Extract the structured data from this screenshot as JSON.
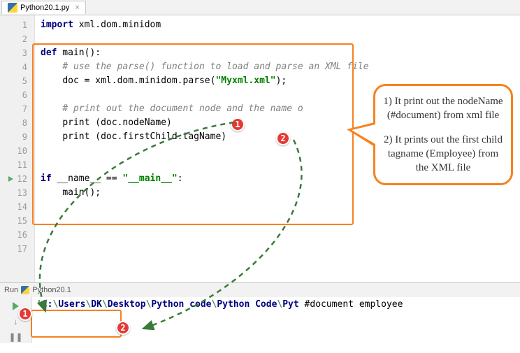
{
  "tab": {
    "filename": "Python20.1.py",
    "close": "×"
  },
  "code": {
    "l1_import": "import",
    "l1_module": " xml.dom.minidom",
    "l3_def": "def",
    "l3_sig": " main():",
    "l4_comment": "# use the parse() function to load and parse an XML file",
    "l5_a": "doc = xml.dom.minidom.parse(",
    "l5_str": "\"Myxml.xml\"",
    "l5_b": ");",
    "l7_comment": "# print out the document node and the name o",
    "l8_a": "print (doc.nodeName)",
    "l9_a": "print (doc.firstChild.tagName)",
    "l12_if": "if",
    "l12_a": " __name__ == ",
    "l12_str": "\"__main__\"",
    "l12_b": ":",
    "l13_a": "main();"
  },
  "gutter": {
    "lines": [
      "1",
      "2",
      "3",
      "4",
      "5",
      "6",
      "7",
      "8",
      "9",
      "10",
      "11",
      "12",
      "13",
      "14",
      "15",
      "16",
      "17"
    ]
  },
  "callout": {
    "p1": "1) It print out the nodeName (#document) from xml file",
    "p2": "2) It prints out the first child tagname (Employee) from the XML file"
  },
  "run": {
    "header_label": "Run",
    "config": "Python20.1",
    "path": "'C:\\Users\\DK\\Desktop\\Python code\\Python Code\\Pyt",
    "out1": "#document",
    "out2": "employee"
  },
  "badges": {
    "one": "1",
    "two": "2"
  }
}
